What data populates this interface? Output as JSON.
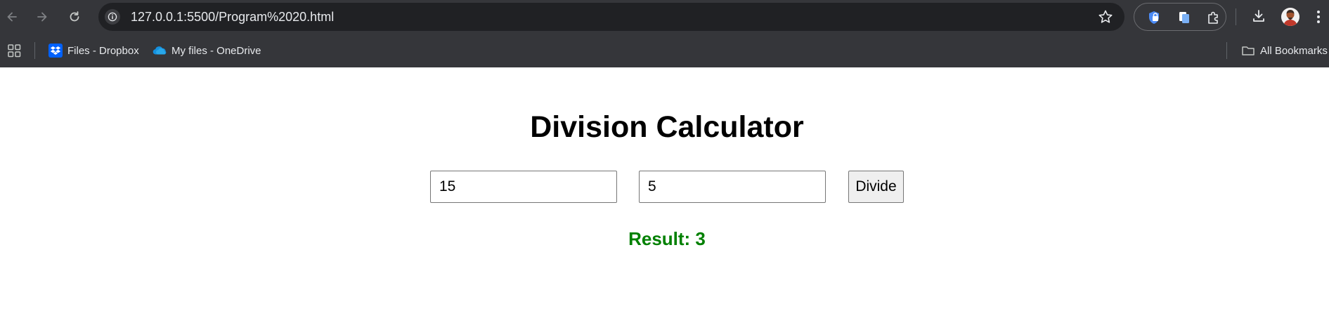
{
  "browser": {
    "url": "127.0.0.1:5500/Program%2020.html",
    "bookmarks": [
      {
        "label": "Files - Dropbox",
        "icon": "dropbox-icon"
      },
      {
        "label": "My files - OneDrive",
        "icon": "onedrive-icon"
      }
    ],
    "all_bookmarks_label": "All Bookmarks"
  },
  "page": {
    "title": "Division Calculator",
    "dividend_value": "15",
    "divisor_value": "5",
    "divide_label": "Divide",
    "result_text": "Result: 3",
    "result_color": "#008000"
  }
}
